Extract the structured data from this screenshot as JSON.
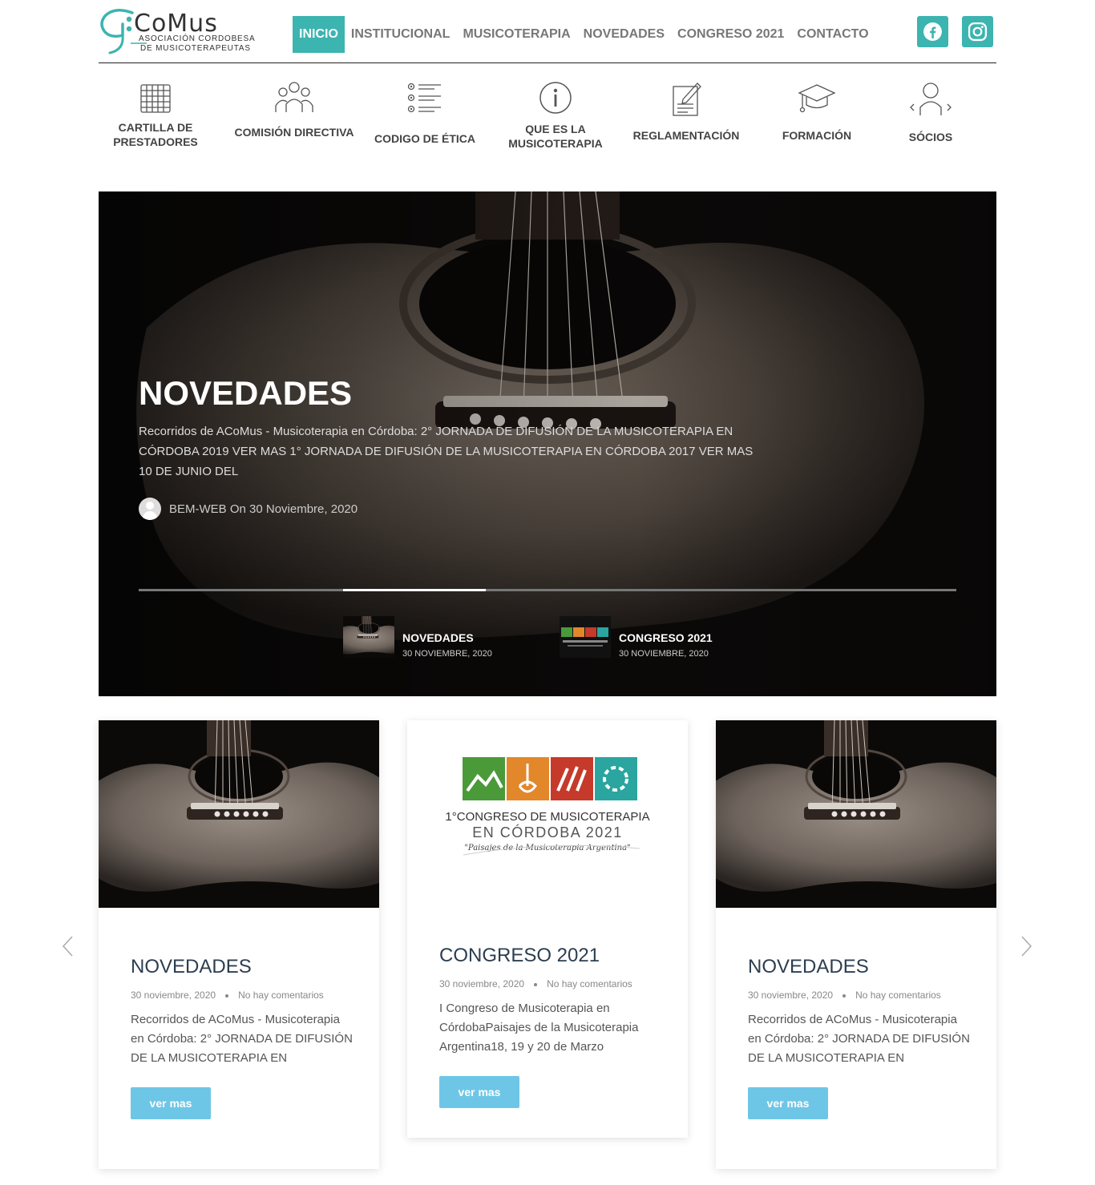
{
  "logo": {
    "main": "CoMus",
    "line1": "ASOCIACIÓN CORDOBESA",
    "line2": "DE MUSICOTERAPEUTAS",
    "colors": {
      "accent": "#3cb4b0",
      "text": "#333333"
    }
  },
  "nav": {
    "items": [
      "INICIO",
      "INSTITUCIONAL",
      "MUSICOTERAPIA",
      "NOVEDADES",
      "CONGRESO 2021",
      "CONTACTO"
    ],
    "active": "INICIO",
    "social": [
      "facebook-icon",
      "instagram-icon"
    ]
  },
  "iconmenu": {
    "items": [
      {
        "label1": "CARTILLA DE",
        "label2": "PRESTADORES",
        "icon": "calendar-grid-icon"
      },
      {
        "label1": "COMISIÓN DIRECTIVA",
        "label2": "",
        "icon": "group-icon"
      },
      {
        "label1": "CODIGO DE ÉTICA",
        "label2": "",
        "icon": "list-icon"
      },
      {
        "label1": "QUE ES LA",
        "label2": "MUSICOTERAPIA",
        "icon": "info-icon"
      },
      {
        "label1": "REGLAMENTACIÓN",
        "label2": "",
        "icon": "document-edit-icon"
      },
      {
        "label1": "FORMACIÓN",
        "label2": "",
        "icon": "graduation-cap-icon"
      },
      {
        "label1": "SÓCIOS",
        "label2": "",
        "icon": "user-icon"
      }
    ]
  },
  "hero": {
    "title": "NOVEDADES",
    "excerpt": "Recorridos de ACoMus - Musicoterapia en Córdoba: 2° JORNADA DE DIFUSIÓN DE LA MUSICOTERAPIA EN CÓRDOBA 2019 VER MAS 1° JORNADA DE DIFUSIÓN DE LA MUSICOTERAPIA EN CÓRDOBA 2017 VER MAS 10 DE JUNIO DEL",
    "author": "BEM-WEB On 30 Noviembre, 2020",
    "progress": 0.175,
    "slides": [
      {
        "title": "NOVEDADES",
        "date": "30 NOVIEMBRE, 2020"
      },
      {
        "title": "CONGRESO 2021",
        "date": "30 NOVIEMBRE, 2020"
      }
    ]
  },
  "cards": [
    {
      "title": "NOVEDADES",
      "date": "30 noviembre, 2020",
      "comments": "No hay comentarios",
      "excerpt": "Recorridos de ACoMus - Musicoterapia en Córdoba: 2° JORNADA DE DIFUSIÓN DE LA MUSICOTERAPIA EN",
      "button": "ver mas"
    },
    {
      "title": "CONGRESO 2021",
      "date": "30 noviembre, 2020",
      "comments": "No hay comentarios",
      "excerpt": "I Congreso de Musicoterapia en CórdobaPaisajes de la Musicoterapia Argentina18, 19 y 20 de Marzo",
      "button": "ver mas",
      "image_text": {
        "line1": "1°CONGRESO DE MUSICOTERAPIA",
        "line2": "EN CÓRDOBA 2021",
        "line3": "\"Paisajes de la Musicoterapia Argentina\""
      }
    },
    {
      "title": "NOVEDADES",
      "date": "30 noviembre, 2020",
      "comments": "No hay comentarios",
      "excerpt": "Recorridos de ACoMus - Musicoterapia en Córdoba: 2° JORNADA DE DIFUSIÓN DE LA MUSICOTERAPIA EN",
      "button": "ver mas"
    }
  ],
  "carousel": {
    "prev": "chevron-left-icon",
    "next": "chevron-right-icon"
  },
  "colors": {
    "button": "#6ec6e6",
    "card_title": "#2d3e50",
    "teal": "#3cb4b0"
  }
}
